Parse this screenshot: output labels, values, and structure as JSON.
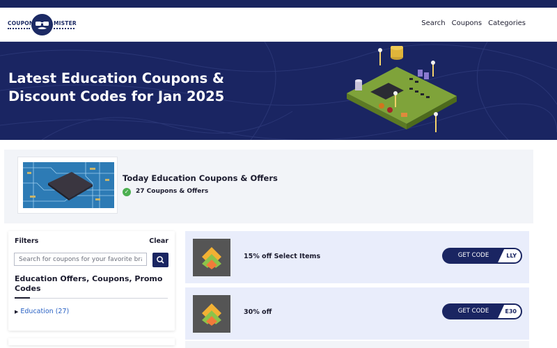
{
  "logo": {
    "left_word": "COUPON",
    "right_word": "MISTER"
  },
  "nav": {
    "items": [
      "Search",
      "Coupons",
      "Categories"
    ]
  },
  "hero": {
    "title": "Latest Education Coupons & Discount Codes for Jan 2025"
  },
  "summary": {
    "title": "Today Education Coupons & Offers",
    "count_text": "27 Coupons & Offers"
  },
  "filters": {
    "label": "Filters",
    "clear": "Clear",
    "search_placeholder": "Search for coupons for your favorite brands",
    "heading": "Education Offers, Coupons, Promo Codes",
    "category": "Education (27)"
  },
  "coupons": [
    {
      "title": "15% off Select Items",
      "button": "GET CODE",
      "code_peek": "LLY"
    },
    {
      "title": "30% off",
      "button": "GET CODE",
      "code_peek": "E30"
    }
  ],
  "colors": {
    "navy": "#1a2562",
    "accent_green": "#4caf50",
    "card_bg": "#e9edfb"
  }
}
